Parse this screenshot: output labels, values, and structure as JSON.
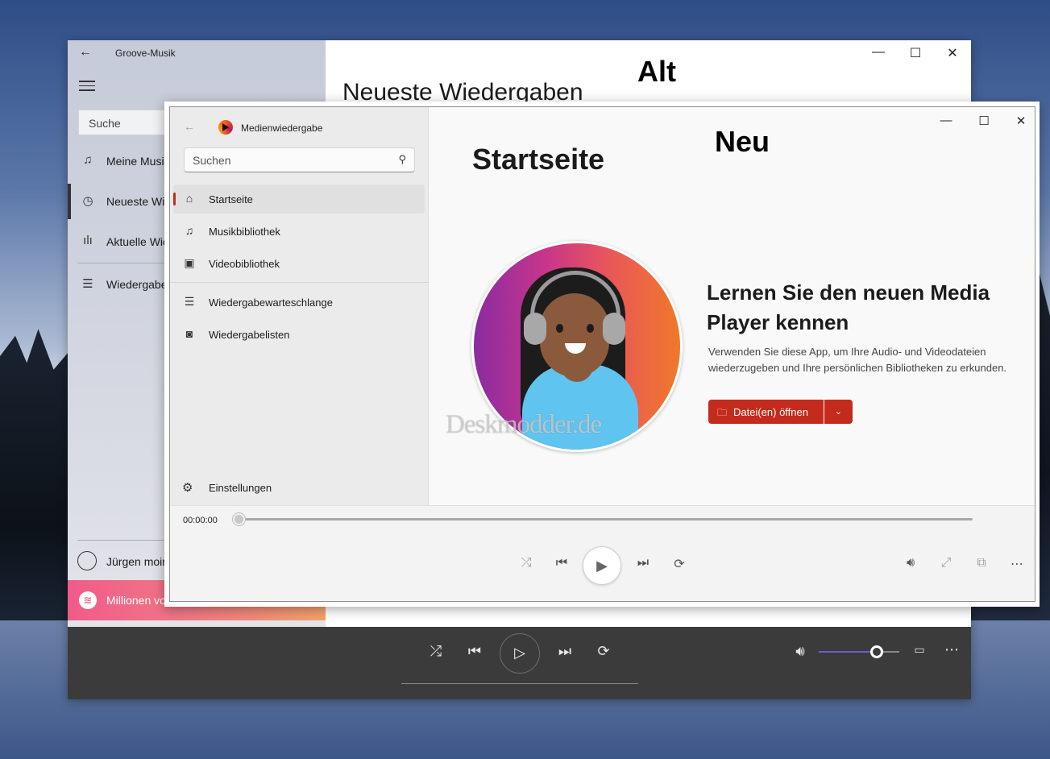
{
  "old_window": {
    "title": "Groove-Musik",
    "label_overlay": "Alt",
    "search_placeholder": "Suche",
    "page_title": "Neueste Wiedergaben",
    "nav": [
      {
        "label": "Meine Musik",
        "icon": "music-note-icon"
      },
      {
        "label": "Neueste Wiedergaben",
        "icon": "clock-icon"
      },
      {
        "label": "Aktuelle Wiedergabe",
        "icon": "equalizer-icon"
      },
      {
        "label": "Wiedergabelisten",
        "icon": "playlist-icon"
      }
    ],
    "user_name": "Jürgen moin",
    "spotify_promo": "Millionen von Songs"
  },
  "new_window": {
    "title": "Medienwiedergabe",
    "label_overlay": "Neu",
    "search_placeholder": "Suchen",
    "page_title": "Startseite",
    "nav": [
      {
        "label": "Startseite",
        "icon": "home-icon"
      },
      {
        "label": "Musikbibliothek",
        "icon": "music-note-icon"
      },
      {
        "label": "Videobibliothek",
        "icon": "film-icon"
      },
      {
        "label": "Wiedergabewarteschlange",
        "icon": "queue-icon"
      },
      {
        "label": "Wiedergabelisten",
        "icon": "playlist-icon"
      }
    ],
    "settings_label": "Einstellungen",
    "promo_title": "Lernen Sie den neuen Media Player kennen",
    "promo_text": "Verwenden Sie diese App, um Ihre Audio- und Videodateien wiederzugeben und Ihre persönlichen Bibliotheken zu erkunden.",
    "open_button": "Datei(en) öffnen",
    "watermark": "Deskmodder.de",
    "player": {
      "time": "00:00:00",
      "progress": 0
    }
  },
  "colors": {
    "accent_red": "#c42b1c",
    "old_player_bg": "#3b3b3b",
    "volume_accent": "#6a5cd6"
  },
  "old_player": {
    "volume": 0.72
  }
}
